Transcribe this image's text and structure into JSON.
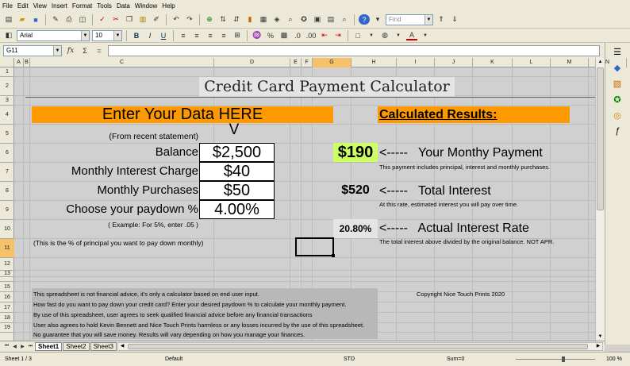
{
  "menu": [
    "File",
    "Edit",
    "View",
    "Insert",
    "Format",
    "Tools",
    "Data",
    "Window",
    "Help"
  ],
  "toolbar": {
    "find_placeholder": "Find",
    "font_name": "Arial",
    "font_size": "10"
  },
  "formula_bar": {
    "name_box": "G11",
    "func_icon": "fx",
    "sum_icon": "Σ",
    "equals_icon": "=",
    "content": ""
  },
  "columns": [
    "A",
    "B",
    "C",
    "D",
    "E",
    "F",
    "G",
    "H",
    "I",
    "J",
    "K",
    "L",
    "M",
    "N"
  ],
  "rows": [
    "1",
    "2",
    "3",
    "4",
    "5",
    "6",
    "7",
    "8",
    "9",
    "10",
    "11",
    "12",
    "13",
    "14",
    "15",
    "16",
    "17",
    "18",
    "19"
  ],
  "sheet": {
    "title": "Credit Card Payment Calculator",
    "enter_header": "Enter Your Data HERE",
    "results_header": "Calculated Results:",
    "from_statement": "(From recent statement)",
    "arrow_v": "V",
    "labels": {
      "balance": "Balance",
      "interest": "Monthly Interest Charge",
      "purchases": "Monthly Purchases",
      "paydown": "Choose your paydown %"
    },
    "values": {
      "balance": "$2,500",
      "interest": "$40",
      "purchases": "$50",
      "paydown": "4.00%"
    },
    "example": "( Example: For 5%, enter .05 )",
    "pct_note": "(This is the % of principal you want to pay down monthly)",
    "results": {
      "payment_value": "$190",
      "payment_label": "<-----   Your Monthy Payment",
      "payment_note": "This payment includes principal, interest and monthly purchases.",
      "total_value": "$520",
      "total_label": "<-----   Total Interest",
      "total_note": "At this rate, estimated interest you will pay over time.",
      "rate_value": "20.80%",
      "rate_label": "<-----   Actual Interest Rate",
      "rate_note": "The total interest above divided by the original balance. NOT APR."
    },
    "disclaimer": [
      "This spreadsheet is not financial advice, it's only a calculator based on end user input.",
      "How fast do you want to pay down your credit card? Enter your desired paydown % to calculate your monthly payment.",
      "By use of this spreadsheet, user agrees to seek qualified financial advice before any financial transactions",
      "User also agrees to hold Kevin Bennett and Nice Touch Prints harmless or any losses incurred by the use of this spreadsheet.",
      "No guarantee that you will save money. Results will vary depending on how you manage your finances."
    ],
    "copyright": "Copyright Nice Touch Prints 2020"
  },
  "tabs": [
    "Sheet1",
    "Sheet2",
    "Sheet3"
  ],
  "status": {
    "sheet": "Sheet 1 / 3",
    "style": "Default",
    "mode": "STD",
    "sum": "Sum=0",
    "zoom": "100 %"
  },
  "colors": {
    "orange": "#ff9900",
    "green": "#ccff66",
    "white": "#ffffff",
    "gridbg": "#d0d0d0"
  }
}
